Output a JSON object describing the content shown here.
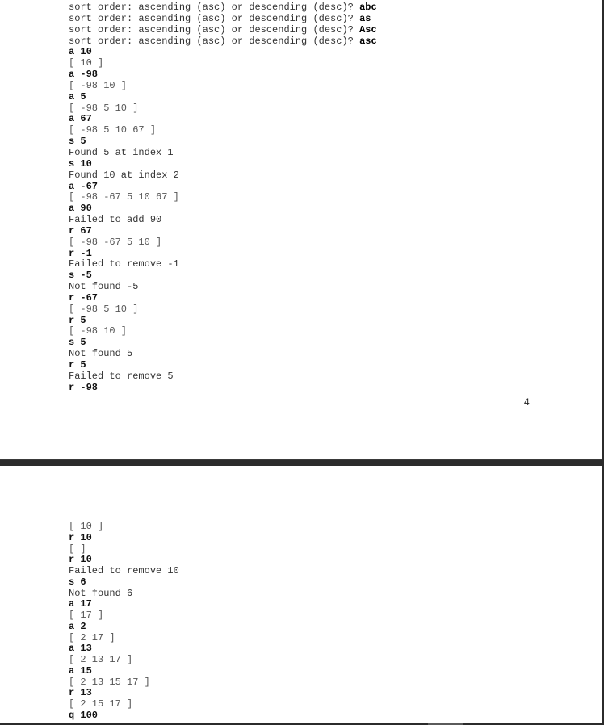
{
  "page_top": {
    "page_number": "4",
    "lines": [
      {
        "type": "prompt",
        "prompt": "sort order: ascending (asc) or descending (desc)? ",
        "answer": "abc"
      },
      {
        "type": "prompt",
        "prompt": "sort order: ascending (asc) or descending (desc)? ",
        "answer": "as"
      },
      {
        "type": "prompt",
        "prompt": "sort order: ascending (asc) or descending (desc)? ",
        "answer": "Asc"
      },
      {
        "type": "prompt",
        "prompt": "sort order: ascending (asc) or descending (desc)? ",
        "answer": "asc"
      },
      {
        "type": "cmd",
        "text": "a 10"
      },
      {
        "type": "arr",
        "text": "[ 10 ]"
      },
      {
        "type": "cmd",
        "text": "a -98"
      },
      {
        "type": "arr",
        "text": "[ -98 10 ]"
      },
      {
        "type": "cmd",
        "text": "a 5"
      },
      {
        "type": "arr",
        "text": "[ -98 5 10 ]"
      },
      {
        "type": "cmd",
        "text": "a 67"
      },
      {
        "type": "arr",
        "text": "[ -98 5 10 67 ]"
      },
      {
        "type": "cmd",
        "text": "s 5"
      },
      {
        "type": "msg",
        "text": "Found 5 at index 1"
      },
      {
        "type": "cmd",
        "text": "s 10"
      },
      {
        "type": "msg",
        "text": "Found 10 at index 2"
      },
      {
        "type": "cmd",
        "text": "a -67"
      },
      {
        "type": "arr",
        "text": "[ -98 -67 5 10 67 ]"
      },
      {
        "type": "cmd",
        "text": "a 90"
      },
      {
        "type": "msg",
        "text": "Failed to add 90"
      },
      {
        "type": "cmd",
        "text": "r 67"
      },
      {
        "type": "arr",
        "text": "[ -98 -67 5 10 ]"
      },
      {
        "type": "cmd",
        "text": "r -1"
      },
      {
        "type": "msg",
        "text": "Failed to remove -1"
      },
      {
        "type": "cmd",
        "text": "s -5"
      },
      {
        "type": "msg",
        "text": "Not found -5"
      },
      {
        "type": "cmd",
        "text": "r -67"
      },
      {
        "type": "arr",
        "text": "[ -98 5 10 ]"
      },
      {
        "type": "cmd",
        "text": "r 5"
      },
      {
        "type": "arr",
        "text": "[ -98 10 ]"
      },
      {
        "type": "cmd",
        "text": "s 5"
      },
      {
        "type": "msg",
        "text": "Not found 5"
      },
      {
        "type": "cmd",
        "text": "r 5"
      },
      {
        "type": "msg",
        "text": "Failed to remove 5"
      },
      {
        "type": "cmd",
        "text": "r -98"
      }
    ]
  },
  "page_bottom": {
    "lines": [
      {
        "type": "arr",
        "text": "[ 10 ]"
      },
      {
        "type": "cmd",
        "text": "r 10"
      },
      {
        "type": "arr",
        "text": "[ ]"
      },
      {
        "type": "cmd",
        "text": "r 10"
      },
      {
        "type": "msg",
        "text": "Failed to remove 10"
      },
      {
        "type": "cmd",
        "text": "s 6"
      },
      {
        "type": "msg",
        "text": "Not found 6"
      },
      {
        "type": "cmd",
        "text": "a 17"
      },
      {
        "type": "arr",
        "text": "[ 17 ]"
      },
      {
        "type": "cmd",
        "text": "a 2"
      },
      {
        "type": "arr",
        "text": "[ 2 17 ]"
      },
      {
        "type": "cmd",
        "text": "a 13"
      },
      {
        "type": "arr",
        "text": "[ 2 13 17 ]"
      },
      {
        "type": "cmd",
        "text": "a 15"
      },
      {
        "type": "arr",
        "text": "[ 2 13 15 17 ]"
      },
      {
        "type": "cmd",
        "text": "r 13"
      },
      {
        "type": "arr",
        "text": "[ 2 15 17 ]"
      },
      {
        "type": "cmd",
        "text": "q 100"
      }
    ]
  }
}
